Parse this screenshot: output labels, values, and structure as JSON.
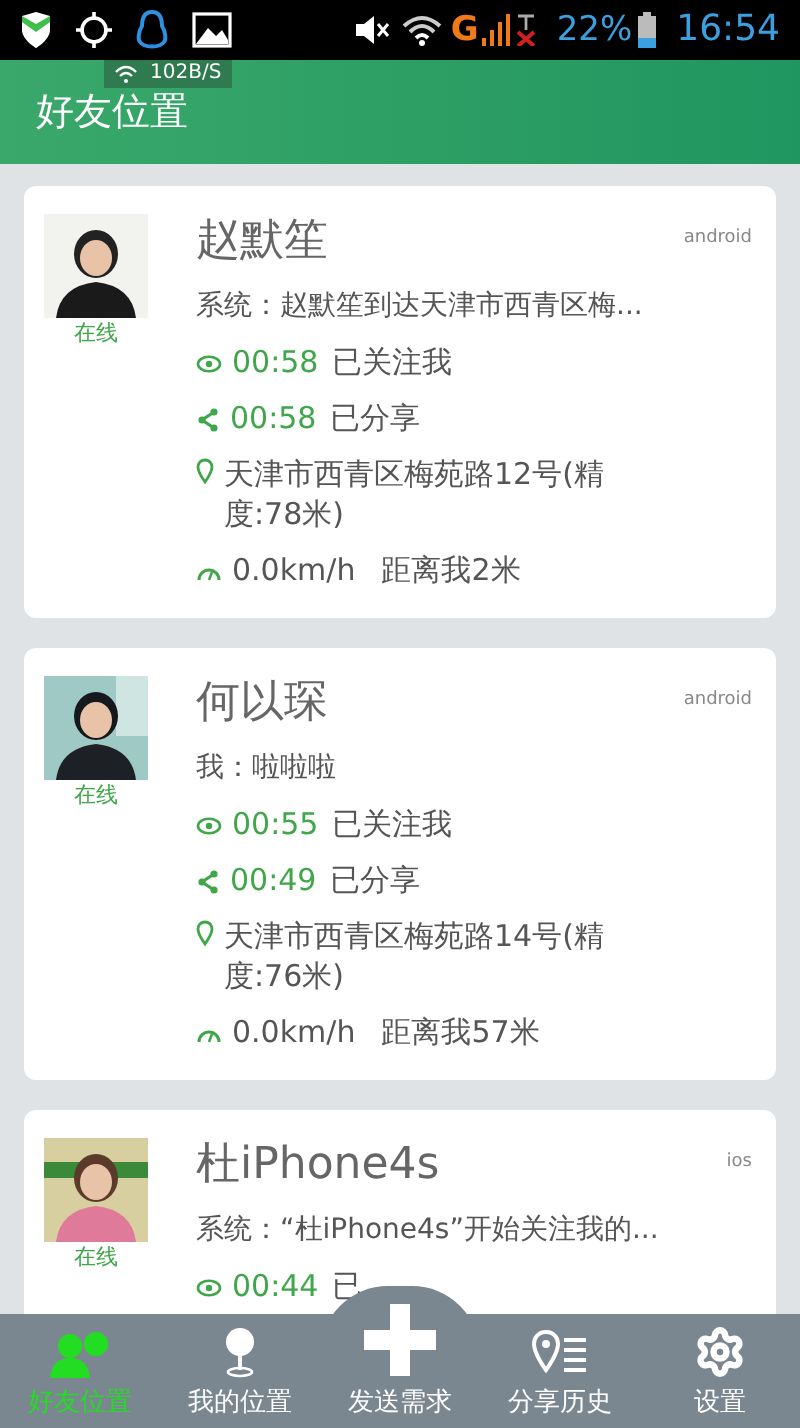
{
  "status_bar": {
    "network_type": "G",
    "battery": "22%",
    "time": "16:54"
  },
  "speed_toast": {
    "speed": "102B/S"
  },
  "header": {
    "title": "好友位置"
  },
  "friends": [
    {
      "name": "赵默笙",
      "platform": "android",
      "presence": "在线",
      "online": true,
      "message": "系统：赵默笙到达天津市西青区梅...",
      "follow_time": "00:58",
      "follow_label": "已关注我",
      "share_time": "00:58",
      "share_label": "已分享",
      "address": "天津市西青区梅苑路12号(精度:78米)",
      "speed": "0.0km/h",
      "distance": "距离我2米"
    },
    {
      "name": "何以琛",
      "platform": "android",
      "presence": "在线",
      "online": true,
      "message": "我：啦啦啦",
      "follow_time": "00:55",
      "follow_label": "已关注我",
      "share_time": "00:49",
      "share_label": "已分享",
      "address": "天津市西青区梅苑路14号(精度:76米)",
      "speed": "0.0km/h",
      "distance": "距离我57米"
    },
    {
      "name": "杜iPhone4s",
      "platform": "ios",
      "presence": "在线",
      "online": true,
      "message": "系统：“杜iPhone4s”开始关注我的...",
      "follow_time": "00:44",
      "follow_label": "已"
    }
  ],
  "bottom_nav": [
    {
      "kind": "friends",
      "label": "好友位置",
      "selected": true
    },
    {
      "kind": "pin",
      "label": "我的位置",
      "selected": false
    },
    {
      "kind": "add",
      "label": "发送需求",
      "selected": false
    },
    {
      "kind": "history",
      "label": "分享历史",
      "selected": false
    },
    {
      "kind": "settings",
      "label": "设置",
      "selected": false
    }
  ]
}
